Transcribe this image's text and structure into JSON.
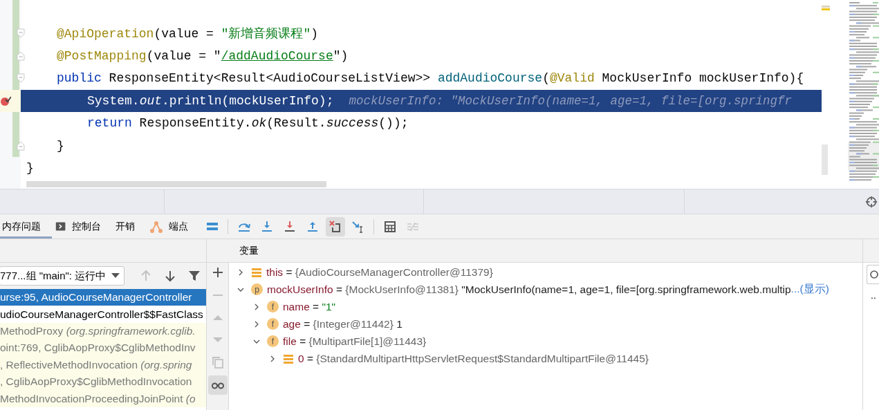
{
  "editor": {
    "lines": [
      {
        "kind": "member",
        "selected": false,
        "breakpoint": false,
        "fold_start": true,
        "fold_end": false,
        "tokens": [
          {
            "text": "@ApiOperation",
            "kind": "annotation"
          },
          {
            "text": "(value = ",
            "kind": "plain"
          },
          {
            "text": "\"新增音频课程\"",
            "kind": "string"
          },
          {
            "text": ")",
            "kind": "plain"
          }
        ]
      },
      {
        "kind": "member",
        "selected": false,
        "breakpoint": false,
        "fold_start": false,
        "fold_end": true,
        "tokens": [
          {
            "text": "@PostMapping",
            "kind": "annotation"
          },
          {
            "text": "(value = \"",
            "kind": "plain"
          },
          {
            "text": "/addAudioCourse",
            "kind": "link"
          },
          {
            "text": "\")",
            "kind": "plain"
          }
        ]
      },
      {
        "kind": "member",
        "selected": false,
        "breakpoint": false,
        "fold_start": true,
        "fold_end": false,
        "tokens": [
          {
            "text": "public",
            "kind": "keyword"
          },
          {
            "text": " ResponseEntity<Result<AudioCourseListView>> ",
            "kind": "plain"
          },
          {
            "text": "addAudioCourse",
            "kind": "method"
          },
          {
            "text": "(",
            "kind": "plain"
          },
          {
            "text": "@Valid",
            "kind": "annotation"
          },
          {
            "text": " MockUserInfo mockUserInfo){",
            "kind": "plain"
          }
        ]
      },
      {
        "kind": "statement",
        "selected": true,
        "breakpoint": true,
        "fold_start": false,
        "fold_end": false,
        "hint": "mockUserInfo: \"MockUserInfo(name=1, age=1, file=[org.springfr",
        "tokens": [
          {
            "text": "System.",
            "kind": "plain"
          },
          {
            "text": "out",
            "kind": "static"
          },
          {
            "text": ".println(mockUserInfo);",
            "kind": "plain"
          }
        ]
      },
      {
        "kind": "statement",
        "selected": false,
        "breakpoint": false,
        "fold_start": false,
        "fold_end": false,
        "tokens": [
          {
            "text": "return",
            "kind": "keyword"
          },
          {
            "text": " ResponseEntity.",
            "kind": "plain"
          },
          {
            "text": "ok",
            "kind": "static"
          },
          {
            "text": "(Result.",
            "kind": "plain"
          },
          {
            "text": "success",
            "kind": "static"
          },
          {
            "text": "());",
            "kind": "plain"
          }
        ]
      },
      {
        "kind": "member",
        "selected": false,
        "breakpoint": false,
        "fold_start": false,
        "fold_end": true,
        "tokens": [
          {
            "text": "}",
            "kind": "plain"
          }
        ]
      },
      {
        "kind": "class",
        "selected": false,
        "breakpoint": false,
        "fold_start": false,
        "fold_end": false,
        "tokens": [
          {
            "text": "}",
            "kind": "plain"
          }
        ]
      }
    ]
  },
  "debug_toolbar": {
    "tabs": [
      {
        "label": "内存问题",
        "kind": "plain",
        "selected": true
      },
      {
        "label": "控制台",
        "kind": "console",
        "selected": false
      },
      {
        "label": "开销",
        "kind": "plain",
        "selected": false
      },
      {
        "label": "端点",
        "kind": "endpoints",
        "selected": false
      }
    ],
    "buttons": [
      {
        "kind": "layout",
        "selected": false,
        "disabled": false
      },
      {
        "kind": "separator"
      },
      {
        "kind": "step-over",
        "selected": false,
        "disabled": false
      },
      {
        "kind": "step-into",
        "selected": false,
        "disabled": false
      },
      {
        "kind": "force-step-into",
        "selected": false,
        "disabled": false
      },
      {
        "kind": "step-out",
        "selected": false,
        "disabled": false
      },
      {
        "kind": "drop-frame",
        "selected": true,
        "disabled": false
      },
      {
        "kind": "run-to-cursor",
        "selected": false,
        "disabled": false
      },
      {
        "kind": "separator"
      },
      {
        "kind": "evaluate",
        "selected": false,
        "disabled": false
      },
      {
        "kind": "trace",
        "selected": false,
        "disabled": true
      }
    ]
  },
  "frames_panel": {
    "thread": "777...组 \"main\": 运行中",
    "nav_buttons": [
      {
        "kind": "up",
        "disabled": true
      },
      {
        "kind": "down",
        "disabled": false
      },
      {
        "kind": "filter",
        "disabled": false
      }
    ],
    "frames": [
      {
        "location": "urse:95, AudioCourseManagerController",
        "selected": true,
        "library": false
      },
      {
        "location": "udioCourseManagerController$$FastClass",
        "selected": false,
        "library": false
      },
      {
        "location": "MethodProxy",
        "package": " (org.springframework.cglib.",
        "selected": false,
        "library": true
      },
      {
        "location": "oint:769, CglibAopProxy$CglibMethodInv",
        "selected": false,
        "library": true
      },
      {
        "location": ", ReflectiveMethodInvocation",
        "package": " (org.spring",
        "selected": false,
        "library": true
      },
      {
        "location": ", CglibAopProxy$CglibMethodInvocation",
        "selected": false,
        "library": true
      },
      {
        "location": "MethodInvocationProceedingJoinPoint",
        "package": " (o",
        "selected": false,
        "library": true
      }
    ]
  },
  "side_toolbar": [
    {
      "kind": "plus",
      "disabled": false,
      "selected": false
    },
    {
      "kind": "minus",
      "disabled": true,
      "selected": false
    },
    {
      "kind": "up",
      "disabled": true,
      "selected": false
    },
    {
      "kind": "down",
      "disabled": true,
      "selected": false
    },
    {
      "kind": "copy",
      "disabled": true,
      "selected": false
    },
    {
      "kind": "glasses",
      "disabled": false,
      "selected": true
    }
  ],
  "variables": {
    "title": "变量",
    "nodes": [
      {
        "name": "this",
        "kind": "object",
        "op": "=",
        "type_ref": "{AudioCourseManagerController@11379}",
        "expanded": false
      },
      {
        "name": "mockUserInfo",
        "kind": "param",
        "badge": "p",
        "op": "=",
        "type_ref": "{MockUserInfo@11381}",
        "value": "\"MockUserInfo(name=1, age=1, file=[org.springframework.web.multip",
        "link": "...(显示)",
        "expanded": true,
        "children": [
          {
            "name": "name",
            "kind": "field",
            "badge": "f",
            "op": "=",
            "string": "\"1\"",
            "expanded": false
          },
          {
            "name": "age",
            "kind": "field",
            "badge": "f",
            "op": "=",
            "type_ref": "{Integer@11442}",
            "value": "1",
            "expanded": false
          },
          {
            "name": "file",
            "kind": "field",
            "badge": "f",
            "op": "=",
            "type_ref": "{MultipartFile[1]@11443}",
            "expanded": true,
            "children": [
              {
                "name": "0",
                "kind": "object",
                "op": "=",
                "type_ref": "{StandardMultipartHttpServletRequest$StandardMultipartFile@11445}",
                "expanded": false
              }
            ]
          }
        ]
      }
    ]
  },
  "right_panel": {
    "item": ".."
  }
}
